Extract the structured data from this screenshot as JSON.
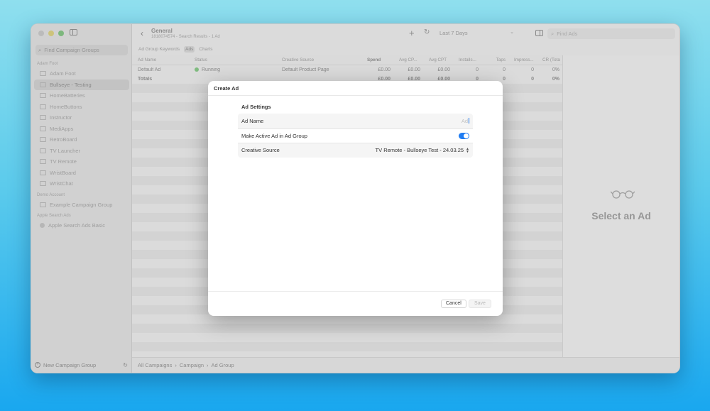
{
  "sidebar": {
    "search_placeholder": "Find Campaign Groups",
    "sections": [
      {
        "title": "Adam Foot",
        "items": [
          "Adam Foot",
          "Bullseye - Testing",
          "HomeBatteries",
          "HomeButtons",
          "Instructor",
          "MediApps",
          "RetroBoard",
          "TV Launcher",
          "TV Remote",
          "WristBoard",
          "WristChat"
        ],
        "selected_index": 1
      },
      {
        "title": "Demo Account",
        "items": [
          "Example Campaign Group"
        ]
      },
      {
        "title": "Apple Search Ads",
        "items": [
          "Apple Search Ads Basic"
        ]
      }
    ],
    "new_group_label": "New Campaign Group"
  },
  "toolbar": {
    "title": "General",
    "subtitle": "1818074574 - Search Results - 1 Ad",
    "date_range": "Last 7 Days",
    "search_placeholder": "Find Ads"
  },
  "tabs": [
    "Ad Group Keywords",
    "Ads",
    "Charts"
  ],
  "active_tab_index": 1,
  "table": {
    "columns": [
      "Ad Name",
      "Status",
      "Creative Source",
      "Spend",
      "Avg CP...",
      "Avg CPT",
      "Installs...",
      "Taps",
      "Impress...",
      "CR (Tota"
    ],
    "rows": [
      [
        "Default Ad",
        "Running",
        "Default Product Page",
        "£0.00",
        "£0.00",
        "£0.00",
        "0",
        "0",
        "0",
        "0%"
      ]
    ],
    "totals": [
      "Totals",
      "",
      "",
      "£0.00",
      "£0.00",
      "£0.00",
      "0",
      "0",
      "0",
      "0%"
    ]
  },
  "detail": {
    "placeholder": "Select an Ad"
  },
  "breadcrumb": [
    "All Campaigns",
    "Campaign",
    "Ad Group"
  ],
  "modal": {
    "title": "Create Ad",
    "section_label": "Ad Settings",
    "ad_name_label": "Ad Name",
    "ad_name_placeholder": "Ad",
    "active_label": "Make Active Ad in Ad Group",
    "active_value": true,
    "creative_label": "Creative Source",
    "creative_value": "TV Remote - Bullseye Test - 24.03.25",
    "cancel_label": "Cancel",
    "save_label": "Save"
  },
  "colors": {
    "accent": "#1f7cf2",
    "running": "#7fc87f"
  }
}
